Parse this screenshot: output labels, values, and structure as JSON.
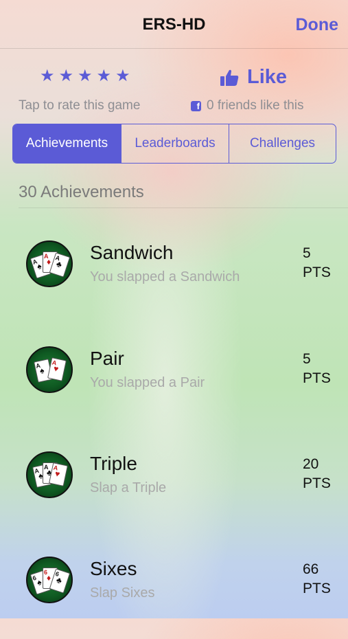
{
  "nav": {
    "title": "ERS-HD",
    "done_label": "Done"
  },
  "rating": {
    "stars": [
      "★",
      "★",
      "★",
      "★",
      "★"
    ],
    "tap_label": "Tap to rate this game"
  },
  "like": {
    "label": "Like",
    "friends_text": "0 friends like this",
    "icon": "thumbs-up-icon",
    "fb_icon": "facebook-icon"
  },
  "tabs": [
    {
      "label": "Achievements",
      "active": true
    },
    {
      "label": "Leaderboards",
      "active": false
    },
    {
      "label": "Challenges",
      "active": false
    }
  ],
  "section": {
    "title": "30 Achievements"
  },
  "achievements": [
    {
      "title": "Sandwich",
      "description": "You slapped a Sandwich",
      "points": "5",
      "unit": "PTS"
    },
    {
      "title": "Pair",
      "description": "You slapped a Pair",
      "points": "5",
      "unit": "PTS"
    },
    {
      "title": "Triple",
      "description": "Slap a Triple",
      "points": "20",
      "unit": "PTS"
    },
    {
      "title": "Sixes",
      "description": "Slap Sixes",
      "points": "66",
      "unit": "PTS"
    }
  ],
  "colors": {
    "accent": "#5b5bd6",
    "secondary_text": "#8e8e93",
    "felt": "#1f7a33"
  }
}
